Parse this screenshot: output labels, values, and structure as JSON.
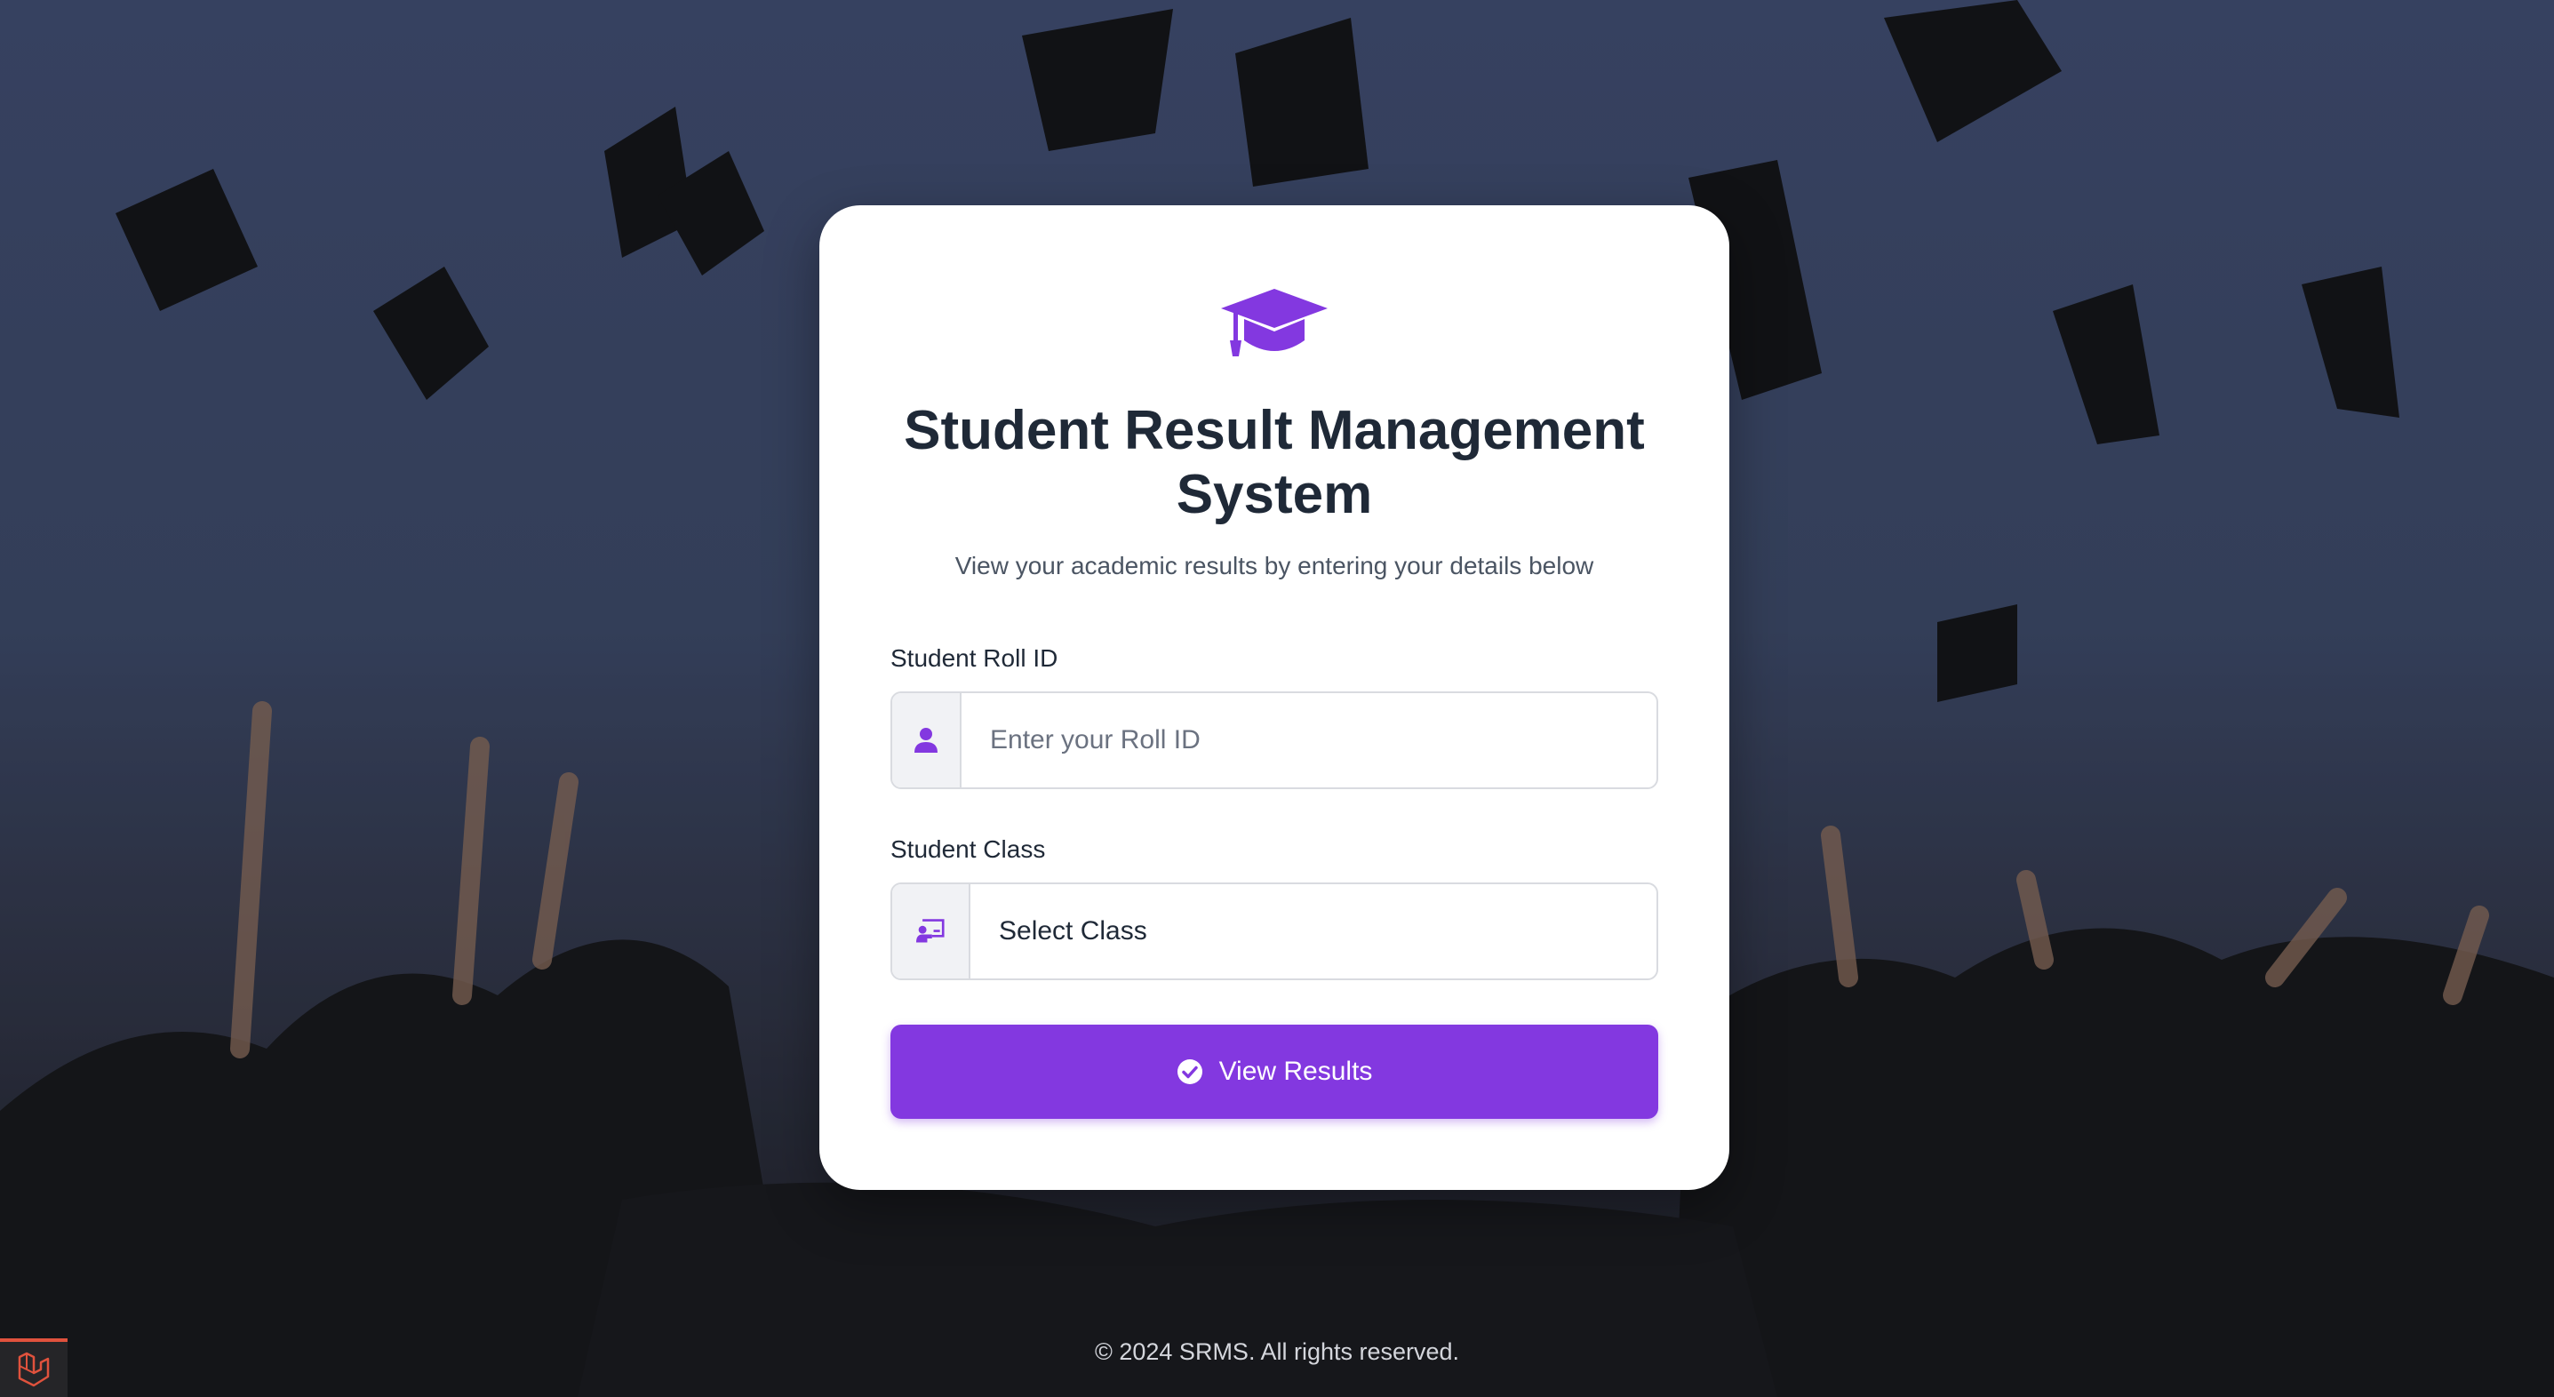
{
  "app": {
    "title": "Student Result Management System",
    "subtitle": "View your academic results by entering your details below",
    "logo_icon": "graduation-cap-icon"
  },
  "form": {
    "roll_id": {
      "label": "Student Roll ID",
      "placeholder": "Enter your Roll ID",
      "value": "",
      "icon": "user-icon"
    },
    "class": {
      "label": "Student Class",
      "selected": "Select Class",
      "icon": "chalkboard-teacher-icon"
    },
    "submit": {
      "label": "View Results",
      "icon": "check-circle-icon"
    }
  },
  "footer": {
    "text": "© 2024 SRMS. All rights reserved."
  },
  "corner_badge": {
    "icon": "laravel-icon"
  },
  "colors": {
    "accent": "#8338e0",
    "card_background": "#ffffff",
    "title_text": "#1f2937",
    "muted_text": "#4b5563",
    "badge_accent": "#e0523d"
  }
}
